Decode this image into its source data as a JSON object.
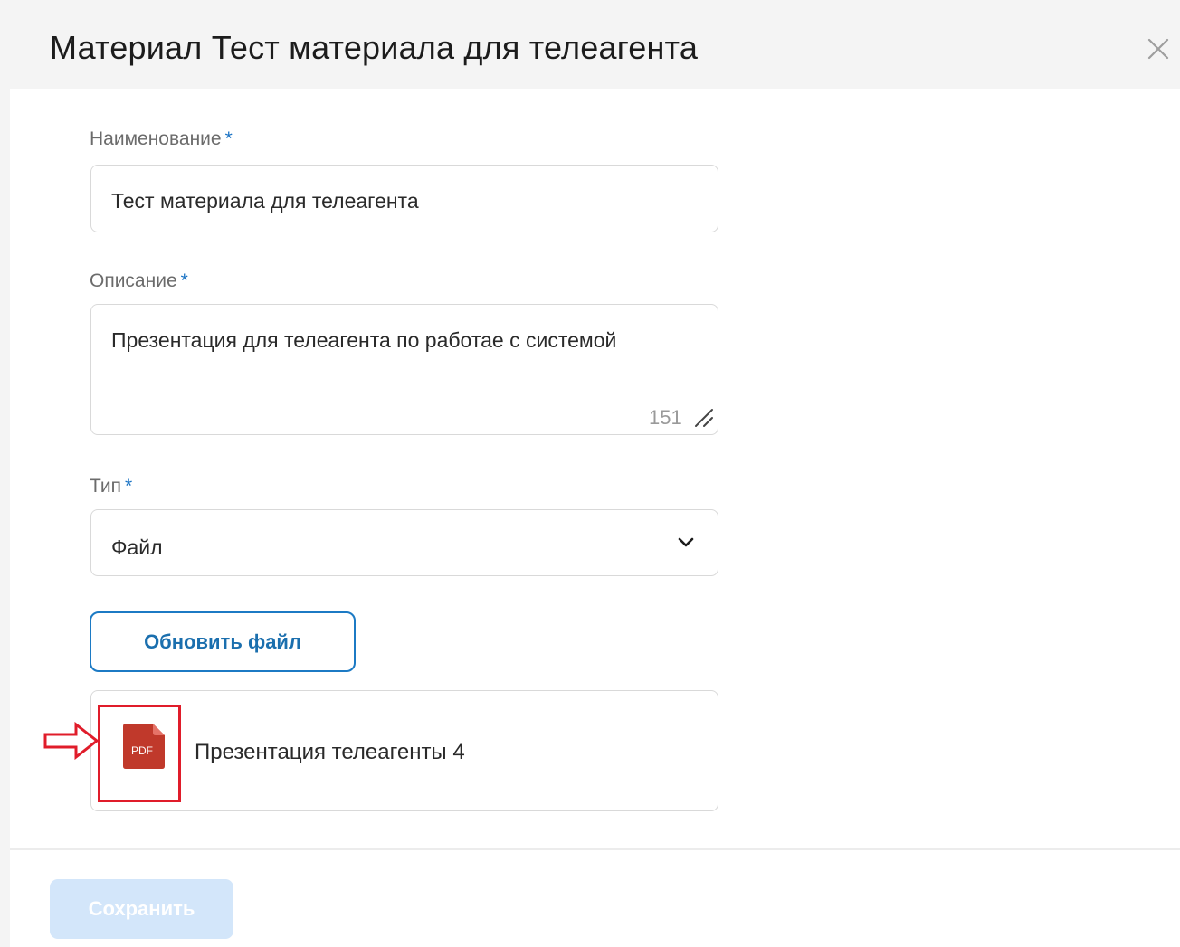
{
  "dialog": {
    "title": "Материал Тест материала для телеагента"
  },
  "form": {
    "name_field": {
      "label": "Наименование",
      "required_mark": "*",
      "value": "Тест материала для телеагента"
    },
    "description_field": {
      "label": "Описание",
      "required_mark": "*",
      "value": "Презентация для телеагента по работае  с системой",
      "counter": "151"
    },
    "type_field": {
      "label": "Тип",
      "required_mark": "*",
      "selected": "Файл"
    },
    "update_file_label": "Обновить файл",
    "attachment": {
      "icon_text": "PDF",
      "file_name": "Презентация телеагенты 4"
    }
  },
  "footer": {
    "save_label": "Сохранить"
  },
  "colors": {
    "accent": "#1c7ac4",
    "required": "#1a73c4",
    "highlight": "#e01c2a",
    "pdf": "#c0392b",
    "save_disabled_bg": "#d3e6fa"
  },
  "icons": {
    "close": "close-icon",
    "dropdown": "chevron-down-icon",
    "resize": "resize-handle-icon",
    "file": "pdf-file-icon",
    "annotation": "arrow-right-icon"
  }
}
